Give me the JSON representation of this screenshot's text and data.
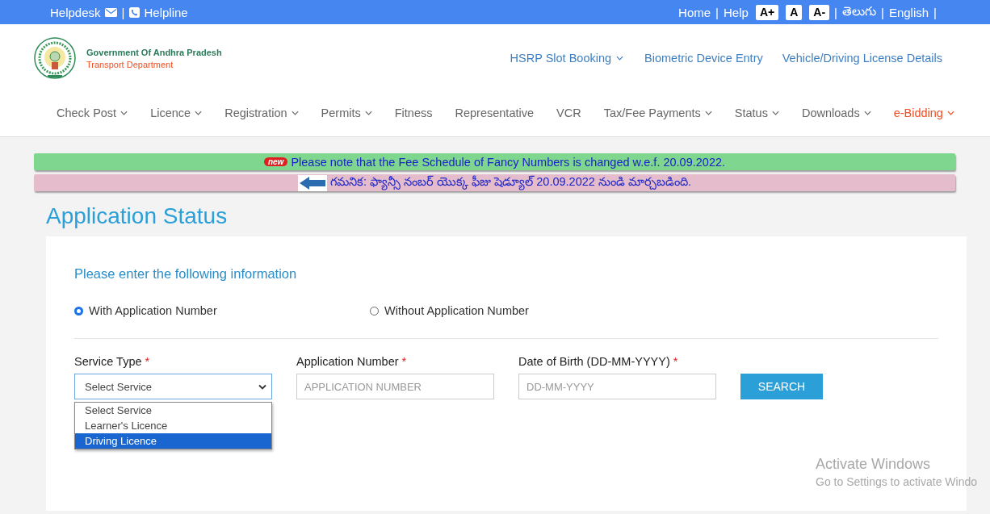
{
  "top_bar": {
    "separator": "|",
    "left_links": [
      "Helpdesk",
      "Helpline"
    ],
    "right_links": [
      "Home",
      "Help"
    ],
    "font_buttons": [
      "A+",
      "A",
      "A-"
    ],
    "languages": [
      "తెలుగు",
      "English"
    ]
  },
  "header": {
    "org_name": "Government Of Andhra Pradesh",
    "department": "Transport Department",
    "top_nav": [
      {
        "label": "HSRP Slot Booking",
        "dropdown": true
      },
      {
        "label": "Biometric Device Entry",
        "dropdown": false
      },
      {
        "label": "Vehicle/Driving License Details",
        "dropdown": false
      }
    ],
    "main_nav": [
      {
        "label": "Check Post",
        "dropdown": true,
        "accent": false
      },
      {
        "label": "Licence",
        "dropdown": true,
        "accent": false
      },
      {
        "label": "Registration",
        "dropdown": true,
        "accent": false
      },
      {
        "label": "Permits",
        "dropdown": true,
        "accent": false
      },
      {
        "label": "Fitness",
        "dropdown": false,
        "accent": false
      },
      {
        "label": "Representative",
        "dropdown": false,
        "accent": false
      },
      {
        "label": "VCR",
        "dropdown": false,
        "accent": false
      },
      {
        "label": "Tax/Fee Payments",
        "dropdown": true,
        "accent": false
      },
      {
        "label": "Status",
        "dropdown": true,
        "accent": false
      },
      {
        "label": "Downloads",
        "dropdown": true,
        "accent": false
      },
      {
        "label": "e-Bidding",
        "dropdown": true,
        "accent": true
      }
    ]
  },
  "notices": [
    {
      "kind": "new",
      "badge": "new",
      "text": "Please note that the Fee Schedule of Fancy Numbers is changed w.e.f. 20.09.2022."
    },
    {
      "kind": "arrow",
      "text": "గమనిక: ఫ్యాన్సీ నంబర్ యొక్క ఫీజు షెడ్యూల్ 20.09.2022 నుండి మార్చబడింది."
    }
  ],
  "page_title": "Application Status",
  "form": {
    "heading": "Please enter the following information",
    "required_mark": "*",
    "modes": [
      {
        "label": "With Application Number",
        "selected": true
      },
      {
        "label": "Without Application Number",
        "selected": false
      }
    ],
    "fields": [
      {
        "kind": "select",
        "label": "Service Type",
        "required": true,
        "value": "Select Service",
        "expanded": true,
        "options": [
          {
            "label": "Select Service",
            "highlighted": false
          },
          {
            "label": "Learner's Licence",
            "highlighted": false
          },
          {
            "label": "Driving Licence",
            "highlighted": true
          }
        ]
      },
      {
        "kind": "text",
        "label": "Application Number",
        "required": true,
        "placeholder": "APPLICATION NUMBER"
      },
      {
        "kind": "text",
        "label": "Date of Birth (DD-MM-YYYY)",
        "required": true,
        "placeholder": "DD-MM-YYYY"
      }
    ],
    "button": "SEARCH"
  },
  "os_notice": {
    "title": "Activate Windows",
    "subtitle": "Go to Settings to activate Windo"
  }
}
